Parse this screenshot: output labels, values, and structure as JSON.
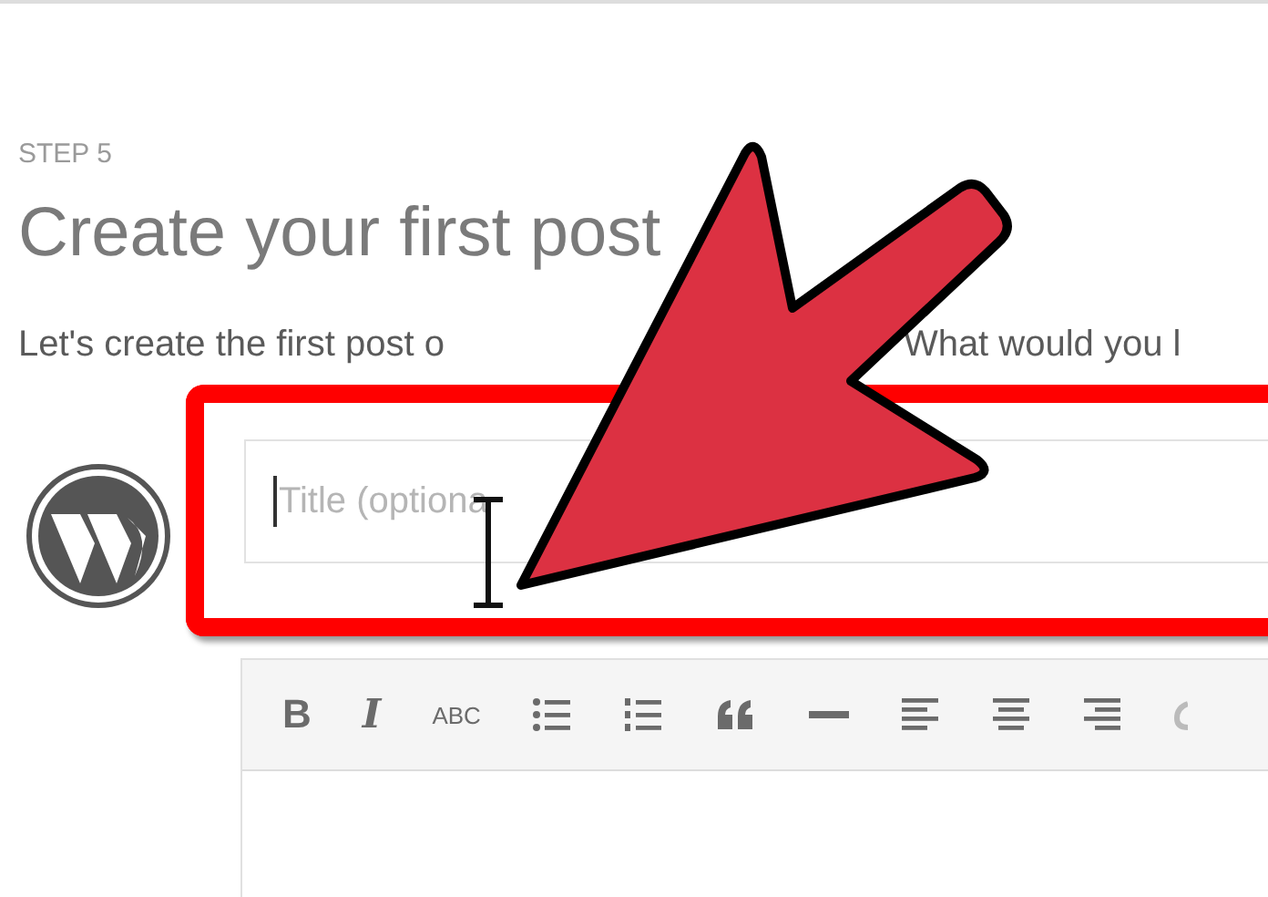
{
  "step_label": "STEP 5",
  "heading": "Create your first post",
  "intro": [
    "Let's create the first post o",
    "What would you l"
  ],
  "title_field": {
    "placeholder": "Title (optiona"
  },
  "toolbar": [
    {
      "kind": "bold",
      "label": "B"
    },
    {
      "kind": "italic",
      "label": "I"
    },
    {
      "kind": "strike",
      "label": "ABC"
    },
    {
      "kind": "bullet-list"
    },
    {
      "kind": "numbered-list"
    },
    {
      "kind": "quote"
    },
    {
      "kind": "rule"
    },
    {
      "kind": "align-left"
    },
    {
      "kind": "align-center"
    },
    {
      "kind": "align-right"
    },
    {
      "kind": "link"
    }
  ]
}
